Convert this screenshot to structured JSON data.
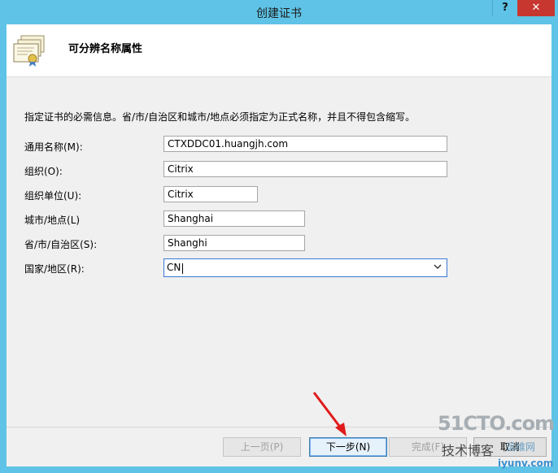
{
  "window": {
    "title": "创建证书",
    "help_label": "?",
    "close_label": "✕"
  },
  "header": {
    "title": "可分辨名称属性",
    "icon": "certificate-icon"
  },
  "instructions": "指定证书的必需信息。省/市/自治区和城市/地点必须指定为正式名称，并且不得包含缩写。",
  "fields": {
    "common_name": {
      "label": "通用名称(M):",
      "value": "CTXDDC01.huangjh.com"
    },
    "organization": {
      "label": "组织(O):",
      "value": "Citrix"
    },
    "org_unit": {
      "label": "组织单位(U):",
      "value": "Citrix"
    },
    "city": {
      "label": "城市/地点(L)",
      "value": "Shanghai"
    },
    "state": {
      "label": "省/市/自治区(S):",
      "value": "Shanghi"
    },
    "country": {
      "label": "国家/地区(R):",
      "value": "CN"
    }
  },
  "buttons": {
    "back": "上一页(P)",
    "next": "下一步(N)",
    "finish": "完成(F)",
    "cancel": "取消"
  },
  "watermark": {
    "brand": "51CTO.com",
    "line1": "技术博客",
    "line2": "运维网",
    "url": "iyunv.com"
  },
  "colors": {
    "titlebar": "#5ec3e6",
    "close": "#c7372f",
    "arrow": "#e01b1b"
  }
}
